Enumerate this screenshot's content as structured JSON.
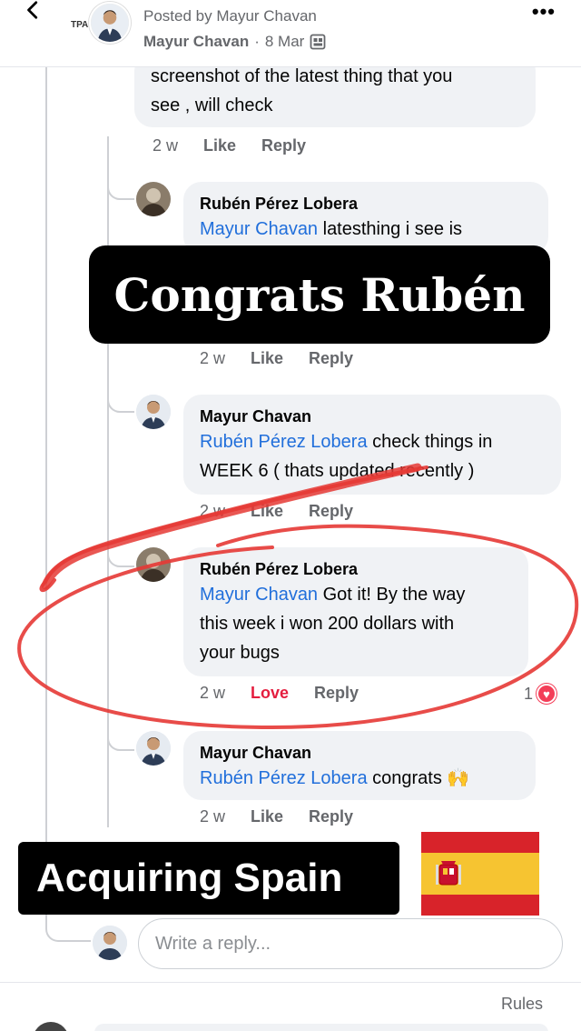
{
  "header": {
    "posted_by": "Posted by Mayur Chavan",
    "author": "Mayur Chavan",
    "date": "8 Mar",
    "separator": "·",
    "group_tag": "TPA"
  },
  "comments": [
    {
      "name": "",
      "mention": "",
      "text_lines": [
        "screenshot of the latest thing that you",
        "see , will check"
      ],
      "time": "2 w",
      "like": "Like",
      "reply": "Reply"
    },
    {
      "name": "Rubén Pérez Lobera",
      "mention": "Mayur Chavan",
      "text": " latesthing i see is",
      "time": "2 w",
      "like": "Like",
      "reply": "Reply"
    },
    {
      "name": "Mayur Chavan",
      "mention": "Rubén Pérez Lobera",
      "text": " check things in",
      "text2": "WEEK 6 ( thats updated recently )",
      "time": "2 w",
      "like": "Like",
      "reply": "Reply"
    },
    {
      "name": "Rubén Pérez Lobera",
      "mention": "Mayur Chavan",
      "text": " Got it! By the way",
      "text2": "this week i won 200 dollars with",
      "text3": "your bugs",
      "time": "2 w",
      "like": "Love",
      "reply": "Reply",
      "reaction_count": "1"
    },
    {
      "name": "Mayur Chavan",
      "mention": "Rubén Pérez Lobera",
      "text": " congrats 🙌",
      "time": "2 w",
      "like": "Like",
      "reply": "Reply"
    }
  ],
  "overlays": {
    "congrats": "Congrats Rubén",
    "spain": "Acquiring Spain"
  },
  "reply_input": {
    "placeholder": "Write a reply..."
  },
  "footer": {
    "rules": "Rules"
  },
  "colors": {
    "mention": "#216fdb",
    "bubble": "#f0f2f5",
    "annotation_red": "#e53935",
    "love": "#e41e3f"
  }
}
